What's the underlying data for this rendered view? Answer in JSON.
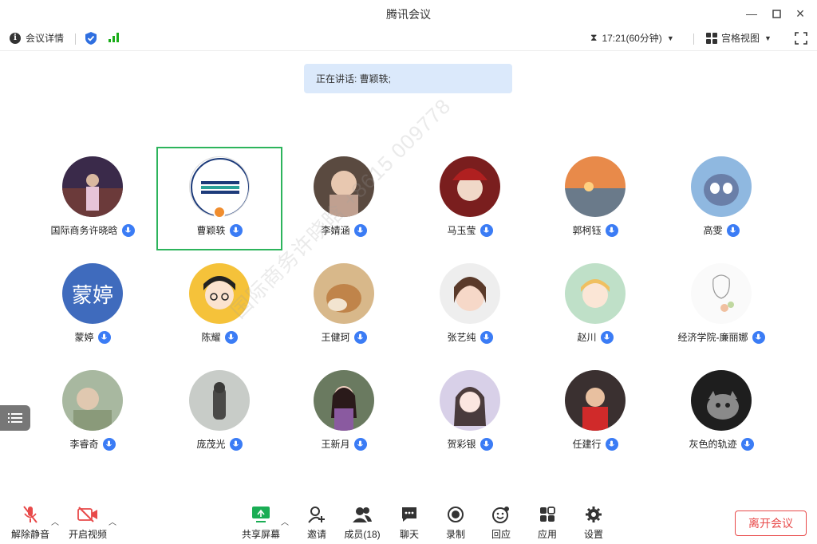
{
  "window": {
    "title": "腾讯会议"
  },
  "toolbar": {
    "meeting_details": "会议详情",
    "time": "17:21(60分钟)",
    "view": "宫格视图"
  },
  "speaking": "正在讲话: 曹颖轶;",
  "watermark": "国际商务许晓晗 +8615     009778",
  "participants": [
    {
      "name": "国际商务许晓晗"
    },
    {
      "name": "曹颖轶"
    },
    {
      "name": "李婧涵"
    },
    {
      "name": "马玉莹"
    },
    {
      "name": "郭柯钰"
    },
    {
      "name": "高雯"
    },
    {
      "name": "蒙婷",
      "avatar_text": "蒙婷"
    },
    {
      "name": "陈耀"
    },
    {
      "name": "王健珂"
    },
    {
      "name": "张艺纯"
    },
    {
      "name": "赵川"
    },
    {
      "name": "经济学院-廉丽娜"
    },
    {
      "name": "李睿奇"
    },
    {
      "name": "庞茂光"
    },
    {
      "name": "王新月"
    },
    {
      "name": "贺彩银"
    },
    {
      "name": "任建行"
    },
    {
      "name": "灰色的轨迹"
    }
  ],
  "bottom": {
    "unmute": "解除静音",
    "start_video": "开启视频",
    "share_screen": "共享屏幕",
    "invite": "邀请",
    "members": "成员(18)",
    "chat": "聊天",
    "record": "录制",
    "reaction": "回应",
    "apps": "应用",
    "settings": "设置",
    "leave": "离开会议"
  },
  "colors": {
    "accent": "#3b7cf5",
    "active_border": "#2db45c",
    "leave": "#e84a4a",
    "banner": "#dbe9fb"
  }
}
